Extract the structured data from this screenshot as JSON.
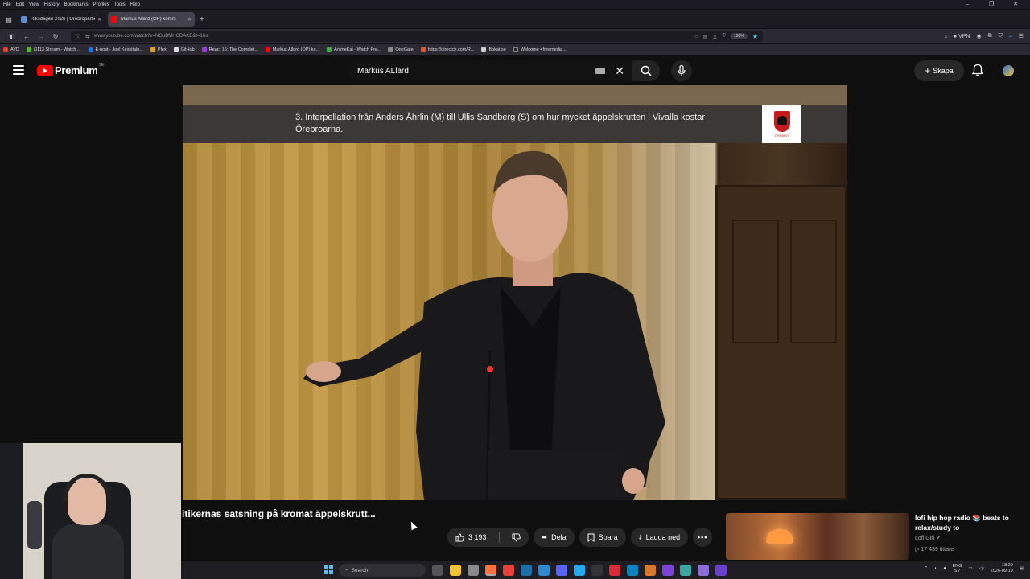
{
  "menubar": {
    "items": [
      "File",
      "Edit",
      "View",
      "History",
      "Bookmarks",
      "Profiles",
      "Tools",
      "Help"
    ]
  },
  "window_controls": {
    "minimize": "–",
    "maximize": "❐",
    "close": "✕"
  },
  "tabs": [
    {
      "label": "Riksdagen 2026 | Örebropartiet",
      "close": "✕",
      "color": "#5b8cd6"
    },
    {
      "label": "Markus Allard (ÖP) komm",
      "close": "✕",
      "color": "#ff0000"
    }
  ],
  "new_tab": "+",
  "navbar": {
    "url": "www.youtube.com/watch?v=NOuBMHCDAKE&t=16s",
    "zoom": "130%",
    "vpn": "VPN"
  },
  "bookmarks": [
    {
      "label": "AYD",
      "color": "#e63b2e"
    },
    {
      "label": "j0113 Stream - Watch ...",
      "color": "#53c100"
    },
    {
      "label": "E-post - Joel Keskitalo...",
      "color": "#1a73e8"
    },
    {
      "label": "Plex",
      "color": "#e5a00d"
    },
    {
      "label": "GitHub",
      "color": "#dddddd"
    },
    {
      "label": "React 16: The Complet...",
      "color": "#a435f0"
    },
    {
      "label": "Markus Allard (ÖP) ko...",
      "color": "#ff0000"
    },
    {
      "label": "AnimeKai - Watch Fre...",
      "color": "#3cb043"
    },
    {
      "label": "OneGate",
      "color": "#888888"
    },
    {
      "label": "https://directch.com/R...",
      "color": "#e4572e"
    },
    {
      "label": "Bokat.se",
      "color": "#cccccc"
    },
    {
      "label": "Welcome • freemedia...",
      "color": "#222222"
    }
  ],
  "youtube": {
    "logo_text": "Premium",
    "region": "SE",
    "search_value": "Markus ALlard",
    "create_label": "Skapa"
  },
  "video": {
    "caption": "3. Interpellation från Anders Åhrlin (M) till Ullis Sandberg (S) om hur mycket äppelskrutten i Vivalla kostar Örebroarna.",
    "crest_label": "ÖREBRO",
    "title_partial": "itikernas satsning på kromat äppelskrutt...",
    "likes": "3 193",
    "share_label": "Dela",
    "save_label": "Spara",
    "download_label": "Ladda ned"
  },
  "recommendation": {
    "title": "lofi hip hop radio 📚 beats to relax/study to",
    "channel": "Lofi Girl",
    "viewers": "17 439 tittare",
    "live_icon": "▷"
  },
  "taskbar": {
    "search_placeholder": "Search",
    "lang_top": "ENG",
    "lang_bottom": "SV",
    "time": "18:29",
    "date": "2026-09-19"
  },
  "colors": {
    "accent": "#ff0000",
    "tab_active": "#42414d",
    "windows_blue": "#4cc2ff"
  }
}
